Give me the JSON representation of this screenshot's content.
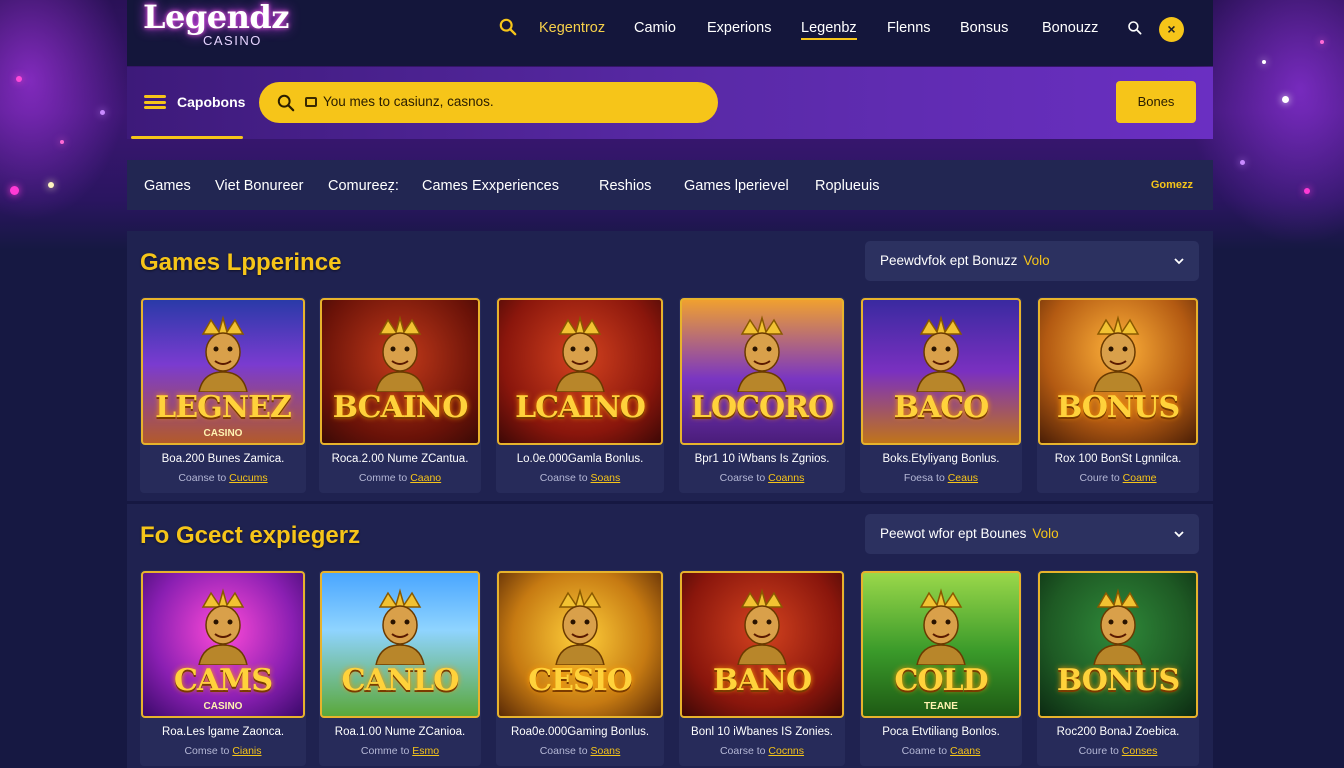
{
  "brand": {
    "name": "Legendz",
    "sub": "CASINO"
  },
  "nav": {
    "items": [
      "Kegentroz",
      "Camio",
      "Experions",
      "Legenbz",
      "Flenns",
      "Bonsus",
      "Bonouzz"
    ],
    "active": "Legenbz",
    "close_icon": "×"
  },
  "search_band": {
    "label": "Capobons",
    "placeholder": "You mes to casiunz, casnos.",
    "button": "Bones"
  },
  "categories": {
    "items": [
      "Games",
      "Viet Bonureer",
      "Comureeẓ:",
      "Cames Exxperiences",
      "Reshios",
      "Games lperievel",
      "Roplueuis"
    ],
    "right": "Gomezz"
  },
  "sections": [
    {
      "title": "Games Lpperince",
      "select_label": "Peewdvfok ept Bonuzz",
      "select_value": "Volo",
      "cards": [
        {
          "thumb": "LEGNEZ",
          "sub": "CASINO",
          "line1": "Boa.200 Bunes Zamica.",
          "line2a": "Coanse to",
          "line2b": "Cucums",
          "theme": "castle"
        },
        {
          "thumb": "BCAINO",
          "sub": "",
          "line1": "Roca.2.00 Nume ZCantua.",
          "line2a": "Comme to",
          "line2b": "Caano",
          "theme": "red"
        },
        {
          "thumb": "LCAINO",
          "sub": "",
          "line1": "Lo.0e.000Gamla Bonlus.",
          "line2a": "Coanse to",
          "line2b": "Soans",
          "theme": "crimson"
        },
        {
          "thumb": "LOCORO",
          "sub": "",
          "line1": "Bpr1 10 iWbans Is Zgnios.",
          "line2a": "Coarse to",
          "line2b": "Coanns",
          "theme": "purple"
        },
        {
          "thumb": "BACO",
          "sub": "",
          "line1": "Boks.Etyliyang Bonlus.",
          "line2a": "Foesa to",
          "line2b": "Ceaus",
          "theme": "violet"
        },
        {
          "thumb": "BONUS",
          "sub": "",
          "line1": "Rox 100 BonSt Lgnnilca.",
          "line2a": "Coure to",
          "line2b": "Coame",
          "theme": "gold"
        }
      ]
    },
    {
      "title": "Fo Gcect expiegerz",
      "select_label": "Peewot wfor ept Bounes",
      "select_value": "Volo",
      "cards": [
        {
          "thumb": "CAMS",
          "sub": "CASINO",
          "line1": "Roa.Les lgame Zaonca.",
          "line2a": "Comse to",
          "line2b": "Cianis",
          "theme": "pink"
        },
        {
          "thumb": "CANLO",
          "sub": "",
          "line1": "Roa.1.00 Nume ZCanioa.",
          "line2a": "Comme to",
          "line2b": "Esmo",
          "theme": "sky"
        },
        {
          "thumb": "CESIO",
          "sub": "",
          "line1": "Roa0e.000Gaming Bonlus.",
          "line2a": "Coanse to",
          "line2b": "Soans",
          "theme": "amber"
        },
        {
          "thumb": "BANO",
          "sub": "",
          "line1": "Bonl 10 iWbanes IS Zonies.",
          "line2a": "Coarse to",
          "line2b": "Cocnns",
          "theme": "crimson"
        },
        {
          "thumb": "COLD",
          "sub": "TEANE",
          "line1": "Poca Etvtiliang Bonlos.",
          "line2a": "Coame to",
          "line2b": "Caans",
          "theme": "green"
        },
        {
          "thumb": "BONUS",
          "sub": "",
          "line1": "Roc200 BonaJ Zoebica.",
          "line2a": "Coure to",
          "line2b": "Conses",
          "theme": "forest"
        }
      ]
    }
  ],
  "colors": {
    "accent": "#f6c519",
    "band": "#5a2aa8",
    "bg": "#161842",
    "panel": "#1f2250"
  },
  "icons": [
    "search-icon",
    "hamburger-icon",
    "chevron-down-icon",
    "close-icon"
  ]
}
